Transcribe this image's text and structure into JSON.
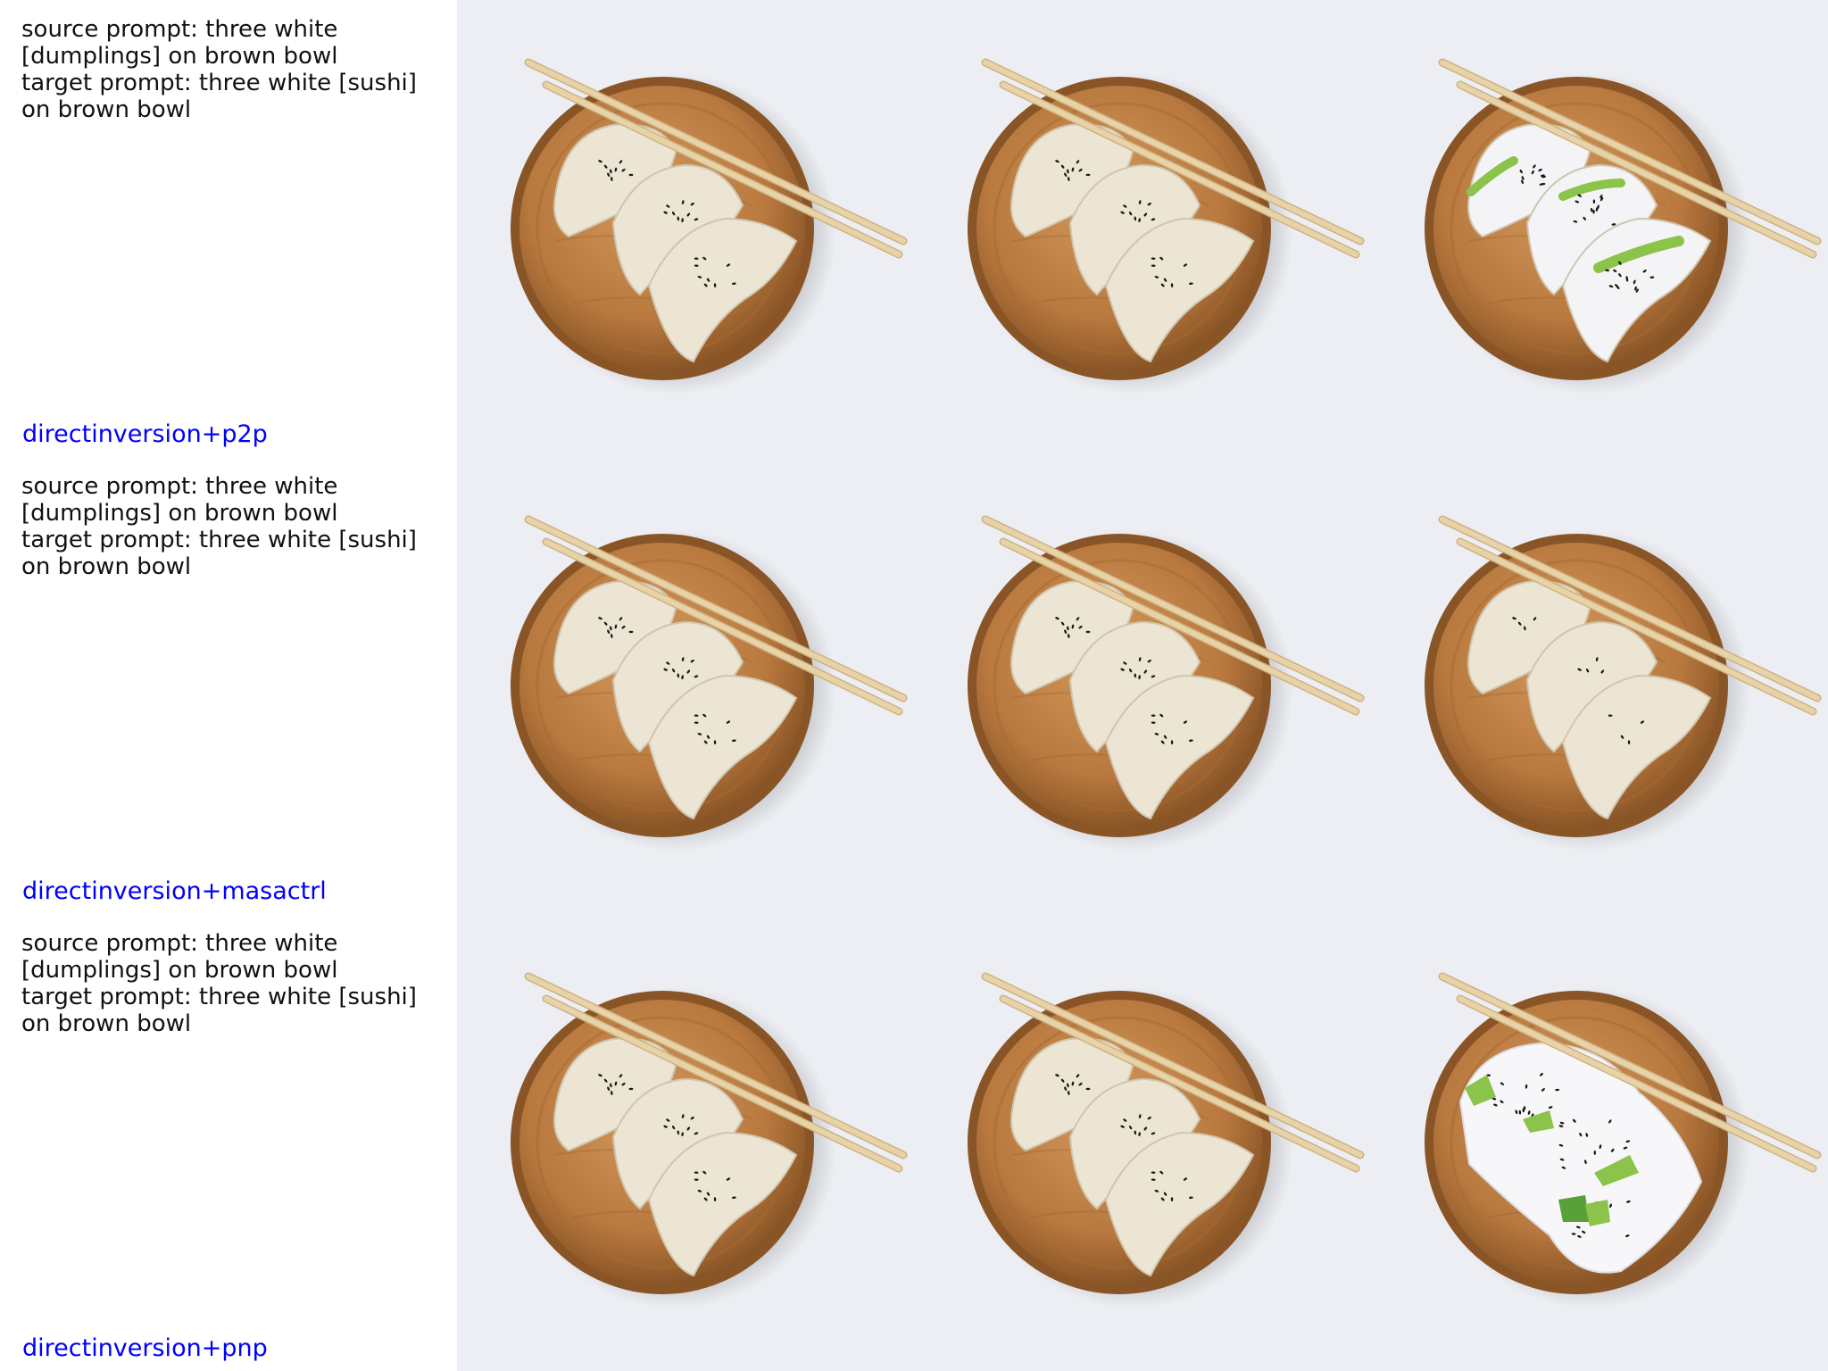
{
  "rows": [
    {
      "source_prompt": "source prompt: three white [dumplings] on brown bowl",
      "target_prompt": "target prompt: three white [sushi] on brown bowl",
      "method": "directinversion+p2p",
      "images": [
        {
          "content": "dumplings",
          "description": "three dumplings on wooden plate with chopsticks (source)"
        },
        {
          "content": "dumplings",
          "description": "reconstructed dumplings on wooden plate"
        },
        {
          "content": "sushi-cucumber",
          "description": "three white sushi pieces with cucumber on wooden plate"
        }
      ]
    },
    {
      "source_prompt": "source prompt: three white [dumplings] on brown bowl",
      "target_prompt": "target prompt: three white [sushi] on brown bowl",
      "method": "directinversion+masactrl",
      "images": [
        {
          "content": "dumplings",
          "description": "three dumplings on wooden plate with chopsticks (source)"
        },
        {
          "content": "dumplings",
          "description": "reconstructed dumplings on wooden plate"
        },
        {
          "content": "dumplings-plain",
          "description": "dumplings with fewer sesame seeds on wooden plate"
        }
      ]
    },
    {
      "source_prompt": "source prompt: three white [dumplings] on brown bowl",
      "target_prompt": "target prompt: three white [sushi] on brown bowl",
      "method": "directinversion+pnp",
      "images": [
        {
          "content": "dumplings",
          "description": "three dumplings on wooden plate with chopsticks (source)"
        },
        {
          "content": "dumplings",
          "description": "reconstructed dumplings on wooden plate"
        },
        {
          "content": "sushi-rice",
          "description": "rice with black sesame and avocado pieces on wooden plate"
        }
      ]
    }
  ],
  "colors": {
    "background": "#eceef3",
    "wood": "#b8783e",
    "wood_dark": "#8a5526",
    "dumpling": "#ece5d3",
    "chopstick": "#e8d3a8",
    "sesame": "#1a1a1a",
    "avocado": "#8cc34a",
    "method_label": "#0000ff"
  }
}
